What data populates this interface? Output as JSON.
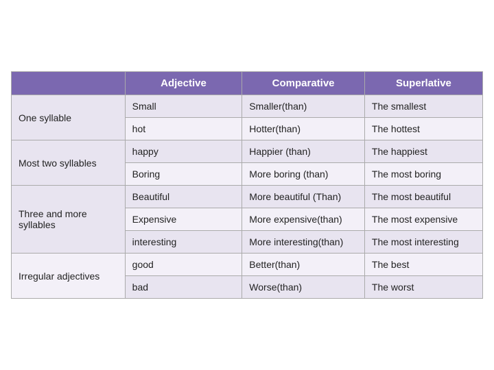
{
  "headers": {
    "blank": "",
    "adjective": "Adjective",
    "comparative": "Comparative",
    "superlative": "Superlative"
  },
  "rows": [
    {
      "category": "One syllable",
      "rowspan": 2,
      "items": [
        {
          "adjective": "Small",
          "comparative": "Smaller(than)",
          "superlative": "The smallest"
        },
        {
          "adjective": "hot",
          "comparative": "Hotter(than)",
          "superlative": "The hottest"
        }
      ]
    },
    {
      "category": "Most  two syllables",
      "rowspan": 2,
      "items": [
        {
          "adjective": "happy",
          "comparative": "Happier (than)",
          "superlative": "The happiest"
        },
        {
          "adjective": "Boring",
          "comparative": "More boring (than)",
          "superlative": "The most boring"
        }
      ]
    },
    {
      "category": "Three and more syllables",
      "rowspan": 3,
      "items": [
        {
          "adjective": "Beautiful",
          "comparative": "More beautiful (Than)",
          "superlative": "The most beautiful"
        },
        {
          "adjective": "Expensive",
          "comparative": "More expensive(than)",
          "superlative": "The most expensive"
        },
        {
          "adjective": "interesting",
          "comparative": "More interesting(than)",
          "superlative": "The most interesting"
        }
      ]
    },
    {
      "category": "Irregular adjectives",
      "rowspan": 2,
      "items": [
        {
          "adjective": "good",
          "comparative": "Better(than)",
          "superlative": "The best"
        },
        {
          "adjective": "bad",
          "comparative": "Worse(than)",
          "superlative": "The worst"
        }
      ]
    }
  ]
}
